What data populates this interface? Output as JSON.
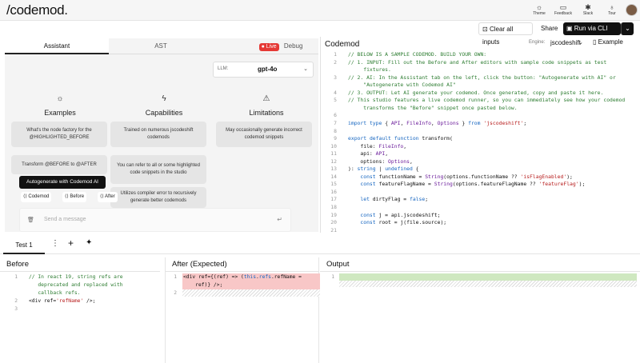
{
  "header": {
    "logo": "/codemod.",
    "icons": [
      {
        "icon": "sun-icon",
        "label": "Theme"
      },
      {
        "icon": "chat-icon",
        "label": "Feedback"
      },
      {
        "icon": "slack-icon",
        "label": "Slack"
      },
      {
        "icon": "bulb-icon",
        "label": "Tour"
      }
    ]
  },
  "actions": {
    "clear": "Clear all inputs",
    "share": "Share",
    "run": "Run via CLI",
    "run_dd": "⌄"
  },
  "left_tabs": {
    "assistant": "Assistant",
    "ast": "AST",
    "live": "Live",
    "debug": "Debug"
  },
  "llm": {
    "label": "LLM:",
    "value": "gpt-4o"
  },
  "columns": {
    "examples": {
      "title": "Examples",
      "icon": "sun-icon"
    },
    "capabilities": {
      "title": "Capabilities",
      "icon": "bolt-icon"
    },
    "limitations": {
      "title": "Limitations",
      "icon": "warning-icon"
    }
  },
  "cards": {
    "ex1": "What's the node factory for the @HIGHLIGHTED_BEFORE",
    "ex2": "Transform @BEFORE to @AFTER",
    "cap1": "Trained on numerous jscodeshift codemods",
    "cap2": "You can refer to all or some highlighted code snippets in the studio",
    "cap3": "Utilizes compiler error to recursively generate better codemods",
    "lim1": "May occasionally generate incorrect codemod snippets"
  },
  "tooltip": "Autogenerate with Codemod AI",
  "chips": {
    "codemod": "Codemod",
    "before": "Before",
    "after": "After"
  },
  "message": {
    "placeholder": "Send a message"
  },
  "codemod_panel": {
    "title": "Codemod",
    "engine_label": "Engine:",
    "engine_value": "jscodeshift",
    "example": "Example"
  },
  "code": [
    {
      "n": "1",
      "t": "// BELOW IS A SAMPLE CODEMOD. BUILD YOUR OWN:"
    },
    {
      "n": "2",
      "t": "// 1. INPUT: Fill out the Before and After editors with sample code snippets as test"
    },
    {
      "n": "",
      "t": "     fixtures."
    },
    {
      "n": "3",
      "t": "// 2. AI: In the Assistant tab on the left, click the button: \"Autogenerate with AI\" or"
    },
    {
      "n": "",
      "t": "     \"Autogenerate with Codemod AI\""
    },
    {
      "n": "4",
      "t": "// 3. OUTPUT: Let AI generate your codemod. Once generated, copy and paste it here."
    },
    {
      "n": "5",
      "t": "// This studio features a live codemod runner, so you can immediately see how your codemod"
    },
    {
      "n": "",
      "t": "     transforms the \"Before\" snippet once pasted below."
    },
    {
      "n": "6",
      "t": ""
    },
    {
      "n": "7",
      "t": "import type { API, FileInfo, Options } from 'jscodeshift';"
    },
    {
      "n": "8",
      "t": ""
    },
    {
      "n": "9",
      "t": "export default function transform("
    },
    {
      "n": "10",
      "t": "    file: FileInfo,"
    },
    {
      "n": "11",
      "t": "    api: API,"
    },
    {
      "n": "12",
      "t": "    options: Options,"
    },
    {
      "n": "13",
      "t": "): string | undefined {"
    },
    {
      "n": "14",
      "t": "    const functionName = String(options.functionName ?? 'isFlagEnabled');"
    },
    {
      "n": "15",
      "t": "    const featureFlagName = String(options.featureFlagName ?? 'featureFlag');"
    },
    {
      "n": "16",
      "t": ""
    },
    {
      "n": "17",
      "t": "    let dirtyFlag = false;"
    },
    {
      "n": "18",
      "t": ""
    },
    {
      "n": "19",
      "t": "    const j = api.jscodeshift;"
    },
    {
      "n": "20",
      "t": "    const root = j(file.source);"
    },
    {
      "n": "21",
      "t": ""
    }
  ],
  "test_tab": {
    "label": "Test 1",
    "more": "⋮",
    "add": "+",
    "wand": "✦"
  },
  "before": {
    "title": "Before",
    "lines": [
      {
        "n": "1",
        "t": "// In react 19, string refs are",
        "c": "cm"
      },
      {
        "n": "",
        "t": "   deprecated and replaced with",
        "c": "cm"
      },
      {
        "n": "",
        "t": "   callback refs.",
        "c": "cm"
      },
      {
        "n": "2",
        "t": "<div ref='refName' />;",
        "c": ""
      },
      {
        "n": "3",
        "t": "",
        "c": ""
      }
    ]
  },
  "after": {
    "title": "After (Expected)",
    "lines": [
      {
        "n": "1",
        "t": "<div ref={(ref) => (this.refs.refName ="
      },
      {
        "n": "",
        "t": "    ref)} />;"
      },
      {
        "n": "2",
        "t": ""
      }
    ]
  },
  "output": {
    "title": "Output",
    "lines": [
      {
        "n": "1",
        "t": ""
      }
    ]
  },
  "colors": {
    "accent": "#111111",
    "live": "#e53935",
    "removed": "#f8c7c7",
    "added": "#cfe8c0"
  }
}
